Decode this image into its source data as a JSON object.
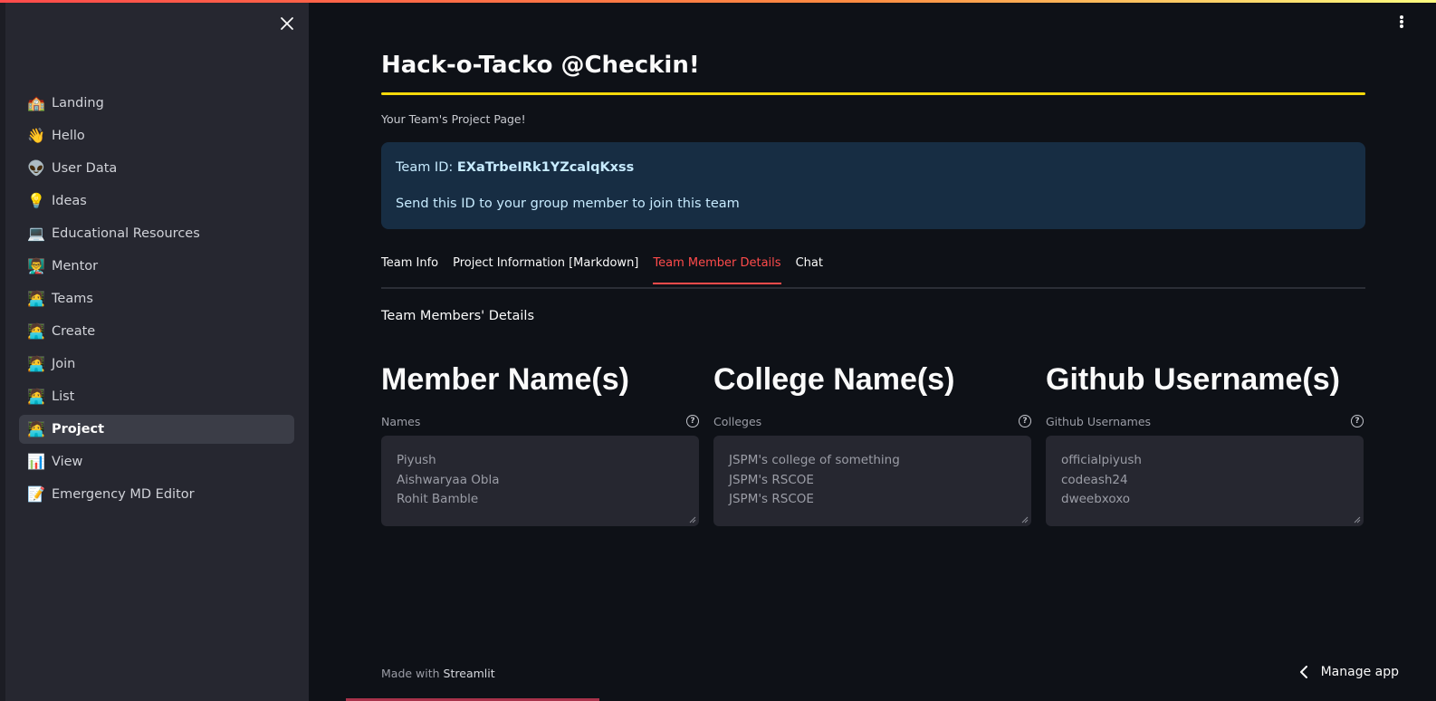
{
  "sidebar": {
    "items": [
      {
        "emoji": "🏫",
        "label": "Landing",
        "active": false
      },
      {
        "emoji": "👋",
        "label": "Hello",
        "active": false
      },
      {
        "emoji": "👽",
        "label": "User Data",
        "active": false
      },
      {
        "emoji": "💡",
        "label": "Ideas",
        "active": false
      },
      {
        "emoji": "💻",
        "label": "Educational Resources",
        "active": false
      },
      {
        "emoji": "👨‍🏫",
        "label": "Mentor",
        "active": false
      },
      {
        "emoji": "🧑‍💻",
        "label": "Teams",
        "active": false
      },
      {
        "emoji": "🧑‍💻",
        "label": "Create",
        "active": false
      },
      {
        "emoji": "🧑‍💻",
        "label": "Join",
        "active": false
      },
      {
        "emoji": "🧑‍💻",
        "label": "List",
        "active": false
      },
      {
        "emoji": "🧑‍💻",
        "label": "Project",
        "active": true
      },
      {
        "emoji": "📊",
        "label": "View",
        "active": false
      },
      {
        "emoji": "📝",
        "label": "Emergency MD Editor",
        "active": false
      }
    ]
  },
  "main": {
    "title": "Hack-o-Tacko @Checkin!",
    "subtitle": "Your Team's Project Page!",
    "info": {
      "team_id_label": "Team ID: ",
      "team_id_value": "EXaTrbeIRk1YZcalqKxss",
      "message": "Send this ID to your group member to join this team"
    },
    "tabs": [
      {
        "label": "Team Info",
        "active": false
      },
      {
        "label": "Project Information [Markdown]",
        "active": false
      },
      {
        "label": "Team Member Details",
        "active": true
      },
      {
        "label": "Chat",
        "active": false
      }
    ],
    "section_heading": "Team Members' Details",
    "columns": [
      {
        "title": "Member Name(s)",
        "field_label": "Names",
        "lines": [
          "Piyush",
          "Aishwaryaa Obla",
          "Rohit Bamble"
        ]
      },
      {
        "title": "College Name(s)",
        "field_label": "Colleges",
        "lines": [
          "JSPM's college of something",
          "JSPM's RSCOE",
          "JSPM's RSCOE"
        ]
      },
      {
        "title": "Github Username(s)",
        "field_label": "Github Usernames",
        "lines": [
          "officialpiyush",
          "codeash24",
          "dweebxoxo"
        ]
      }
    ],
    "help_glyph": "?"
  },
  "footer": {
    "made_with": "Made with ",
    "brand": "Streamlit"
  },
  "manage_app": "Manage app",
  "colors": {
    "accent": "#ff4b4b",
    "title_rule": "#f5d90a",
    "info_bg": "#172d43",
    "sidebar_bg": "#262730",
    "main_bg": "#0e1117"
  }
}
